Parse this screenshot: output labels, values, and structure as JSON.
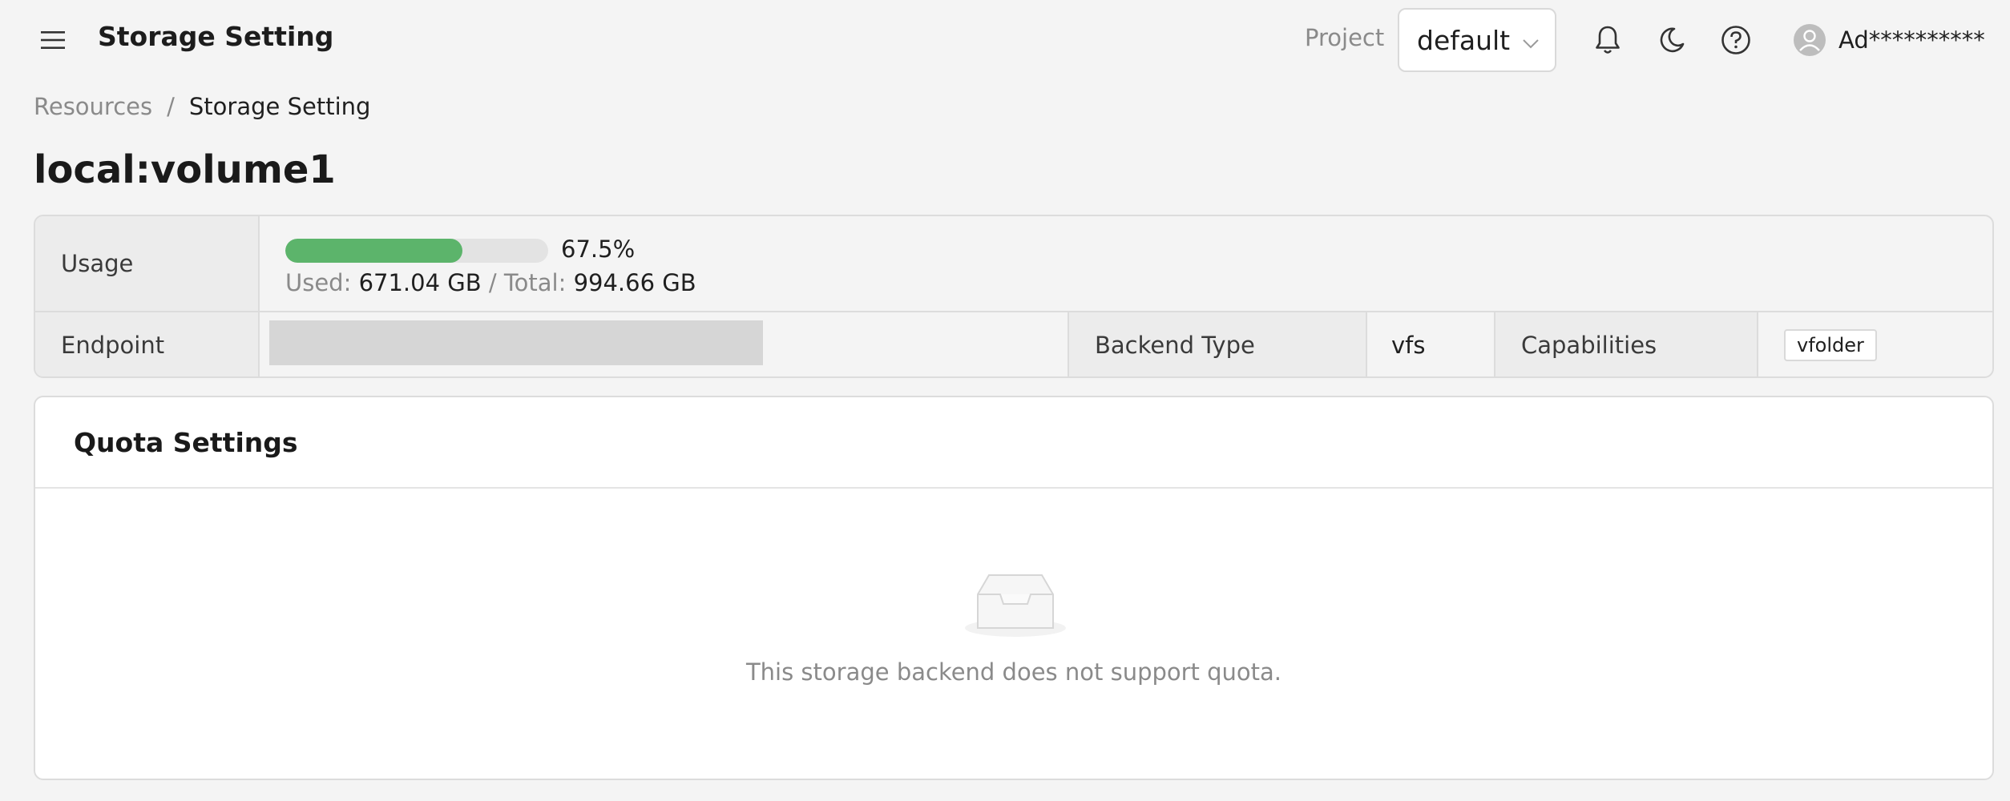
{
  "header": {
    "title": "Storage Setting",
    "project_label": "Project",
    "project_value": "default",
    "username": "Ad**********"
  },
  "breadcrumb": {
    "parent": "Resources",
    "separator": "/",
    "current": "Storage Setting"
  },
  "page_title": "local:volume1",
  "details": {
    "usage": {
      "label": "Usage",
      "percent_text": "67.5%",
      "percent_value": 67.5,
      "used_label": "Used:",
      "used_value": "671.04 GB",
      "total_label": "/ Total:",
      "total_value": "994.66 GB",
      "bar_color": "#5cb46b"
    },
    "endpoint": {
      "label": "Endpoint"
    },
    "backend_type": {
      "label": "Backend Type",
      "value": "vfs"
    },
    "capabilities": {
      "label": "Capabilities",
      "tags": [
        "vfolder"
      ]
    }
  },
  "quota": {
    "title": "Quota Settings",
    "empty_text": "This storage backend does not support quota."
  },
  "icons": {
    "menu": "menu-icon",
    "dropdown": "chevron-down-icon",
    "notifications": "bell-icon",
    "theme": "moon-icon",
    "help": "help-icon",
    "avatar": "user-icon",
    "empty": "empty-inbox-icon"
  }
}
